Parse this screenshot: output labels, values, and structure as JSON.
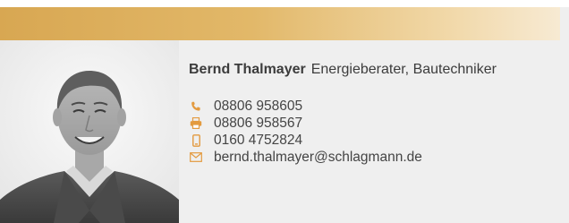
{
  "person": {
    "name": "Bernd Thalmayer",
    "role": "Energieberater, Bautechniker"
  },
  "contacts": {
    "phone": {
      "icon": "phone-icon",
      "value": "08806 958605"
    },
    "fax": {
      "icon": "fax-icon",
      "value": "08806 958567"
    },
    "mobile": {
      "icon": "mobile-icon",
      "value": "0160 4752824"
    },
    "email": {
      "icon": "envelope-icon",
      "value": "bernd.thalmayer@schlagmann.de"
    }
  },
  "colors": {
    "accent": "#e2b869",
    "icon": "#e39a3f",
    "text": "#444444",
    "background": "#efefef"
  }
}
